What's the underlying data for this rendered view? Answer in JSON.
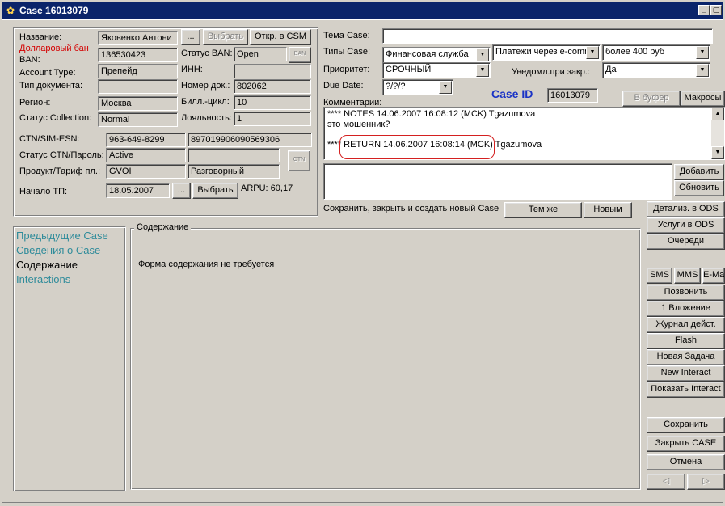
{
  "window": {
    "title": "Case 16013079",
    "minimize": "_",
    "restore": "▢"
  },
  "customer": {
    "name_label": "Название:",
    "name_value": "Яковенко Антони",
    "dollar_ban_label": "Долларовый бан",
    "select_btn": "...",
    "choose_btn": "Выбрать",
    "open_csm_btn": "Откр. в CSM",
    "ban_label": "BAN:",
    "ban_value": "136530423",
    "ban_status_label": "Статус BAN:",
    "ban_status_value": "Open",
    "ban_btn": "BAN",
    "account_type_label": "Account Type:",
    "account_type_value": "Препейд",
    "inn_label": "ИНН:",
    "inn_value": "",
    "doc_type_label": "Тип документа:",
    "doc_type_value": "",
    "doc_num_label": "Номер док.:",
    "doc_num_value": "802062",
    "region_label": "Регион:",
    "region_value": "Москва",
    "bill_cycle_label": "Билл.-цикл:",
    "bill_cycle_value": "10",
    "collection_label": "Статус Collection:",
    "collection_value": "Normal",
    "loyalty_label": "Лояльность:",
    "loyalty_value": "1",
    "ctn_label": "CTN/SIM-ESN:",
    "ctn_value": "963-649-8299",
    "sim_value": "897019906090569306",
    "ctn_status_label": "Статус CTN/Пароль:",
    "ctn_status_value": "Active",
    "ctn_password_value": "",
    "ctn_btn": "CTN",
    "product_label": "Продукт/Тариф пл.:",
    "product_value": "GVOI",
    "tariff_value": "Разговорный",
    "tp_start_label": "Начало ТП:",
    "tp_start_value": "18.05.2007",
    "tp_select_btn": "...",
    "tp_choose_btn": "Выбрать",
    "arpu_label": "ARPU: 60,17"
  },
  "case": {
    "topic_label": "Тема Case:",
    "topic_value": "",
    "types_label": "Типы Case:",
    "type1": "Финансовая служба",
    "type2": "Платежи через e-comm",
    "type3": "более 400 руб",
    "priority_label": "Приоритет:",
    "priority_value": "СРОЧНЫЙ",
    "notify_label": "Уведомл.при закр.:",
    "notify_value": "Да",
    "due_label": "Due Date:",
    "due_value": "?/?/?",
    "case_id_label": "Case ID",
    "case_id_value": "16013079",
    "clipboard_btn": "В буфер",
    "macros_btn": "Макросы",
    "comments_label": "Комментарии:",
    "comment_line1": "**** NOTES 14.06.2007 16:08:12 (MCK) Tgazumova",
    "comment_line2": "это мошенник?",
    "comment_line3": "**** RETURN 14.06.2007 16:08:14 (MCK) Tgazumova",
    "new_comment": "",
    "add_btn": "Добавить",
    "refresh_btn": "Обновить",
    "save_new_label": "Сохранить, закрыть и создать новый Case",
    "same_btn": "Тем же",
    "new_btn": "Новым"
  },
  "nav": {
    "items": [
      "Предыдущие Case",
      "Сведения о Case",
      "Содержание",
      "Interactions"
    ]
  },
  "content": {
    "legend": "Содержание",
    "message": "Форма содержания не требуется"
  },
  "sidebar": {
    "detail_ods": "Детализ. в ODS",
    "services_ods": "Услуги в ODS",
    "queues": "Очереди",
    "sms": "SMS",
    "mms": "MMS",
    "email": "E-Mail",
    "call": "Позвонить",
    "attachment": "1 Вложение",
    "action_log": "Журнал дейст.",
    "flash": "Flash",
    "new_task": "Новая Задача",
    "new_interact": "New Interact",
    "show_interact": "Показать Interact",
    "save": "Сохранить",
    "close_case": "Закрыть CASE",
    "cancel": "Отмена",
    "prev": "◁",
    "next": "▷"
  }
}
